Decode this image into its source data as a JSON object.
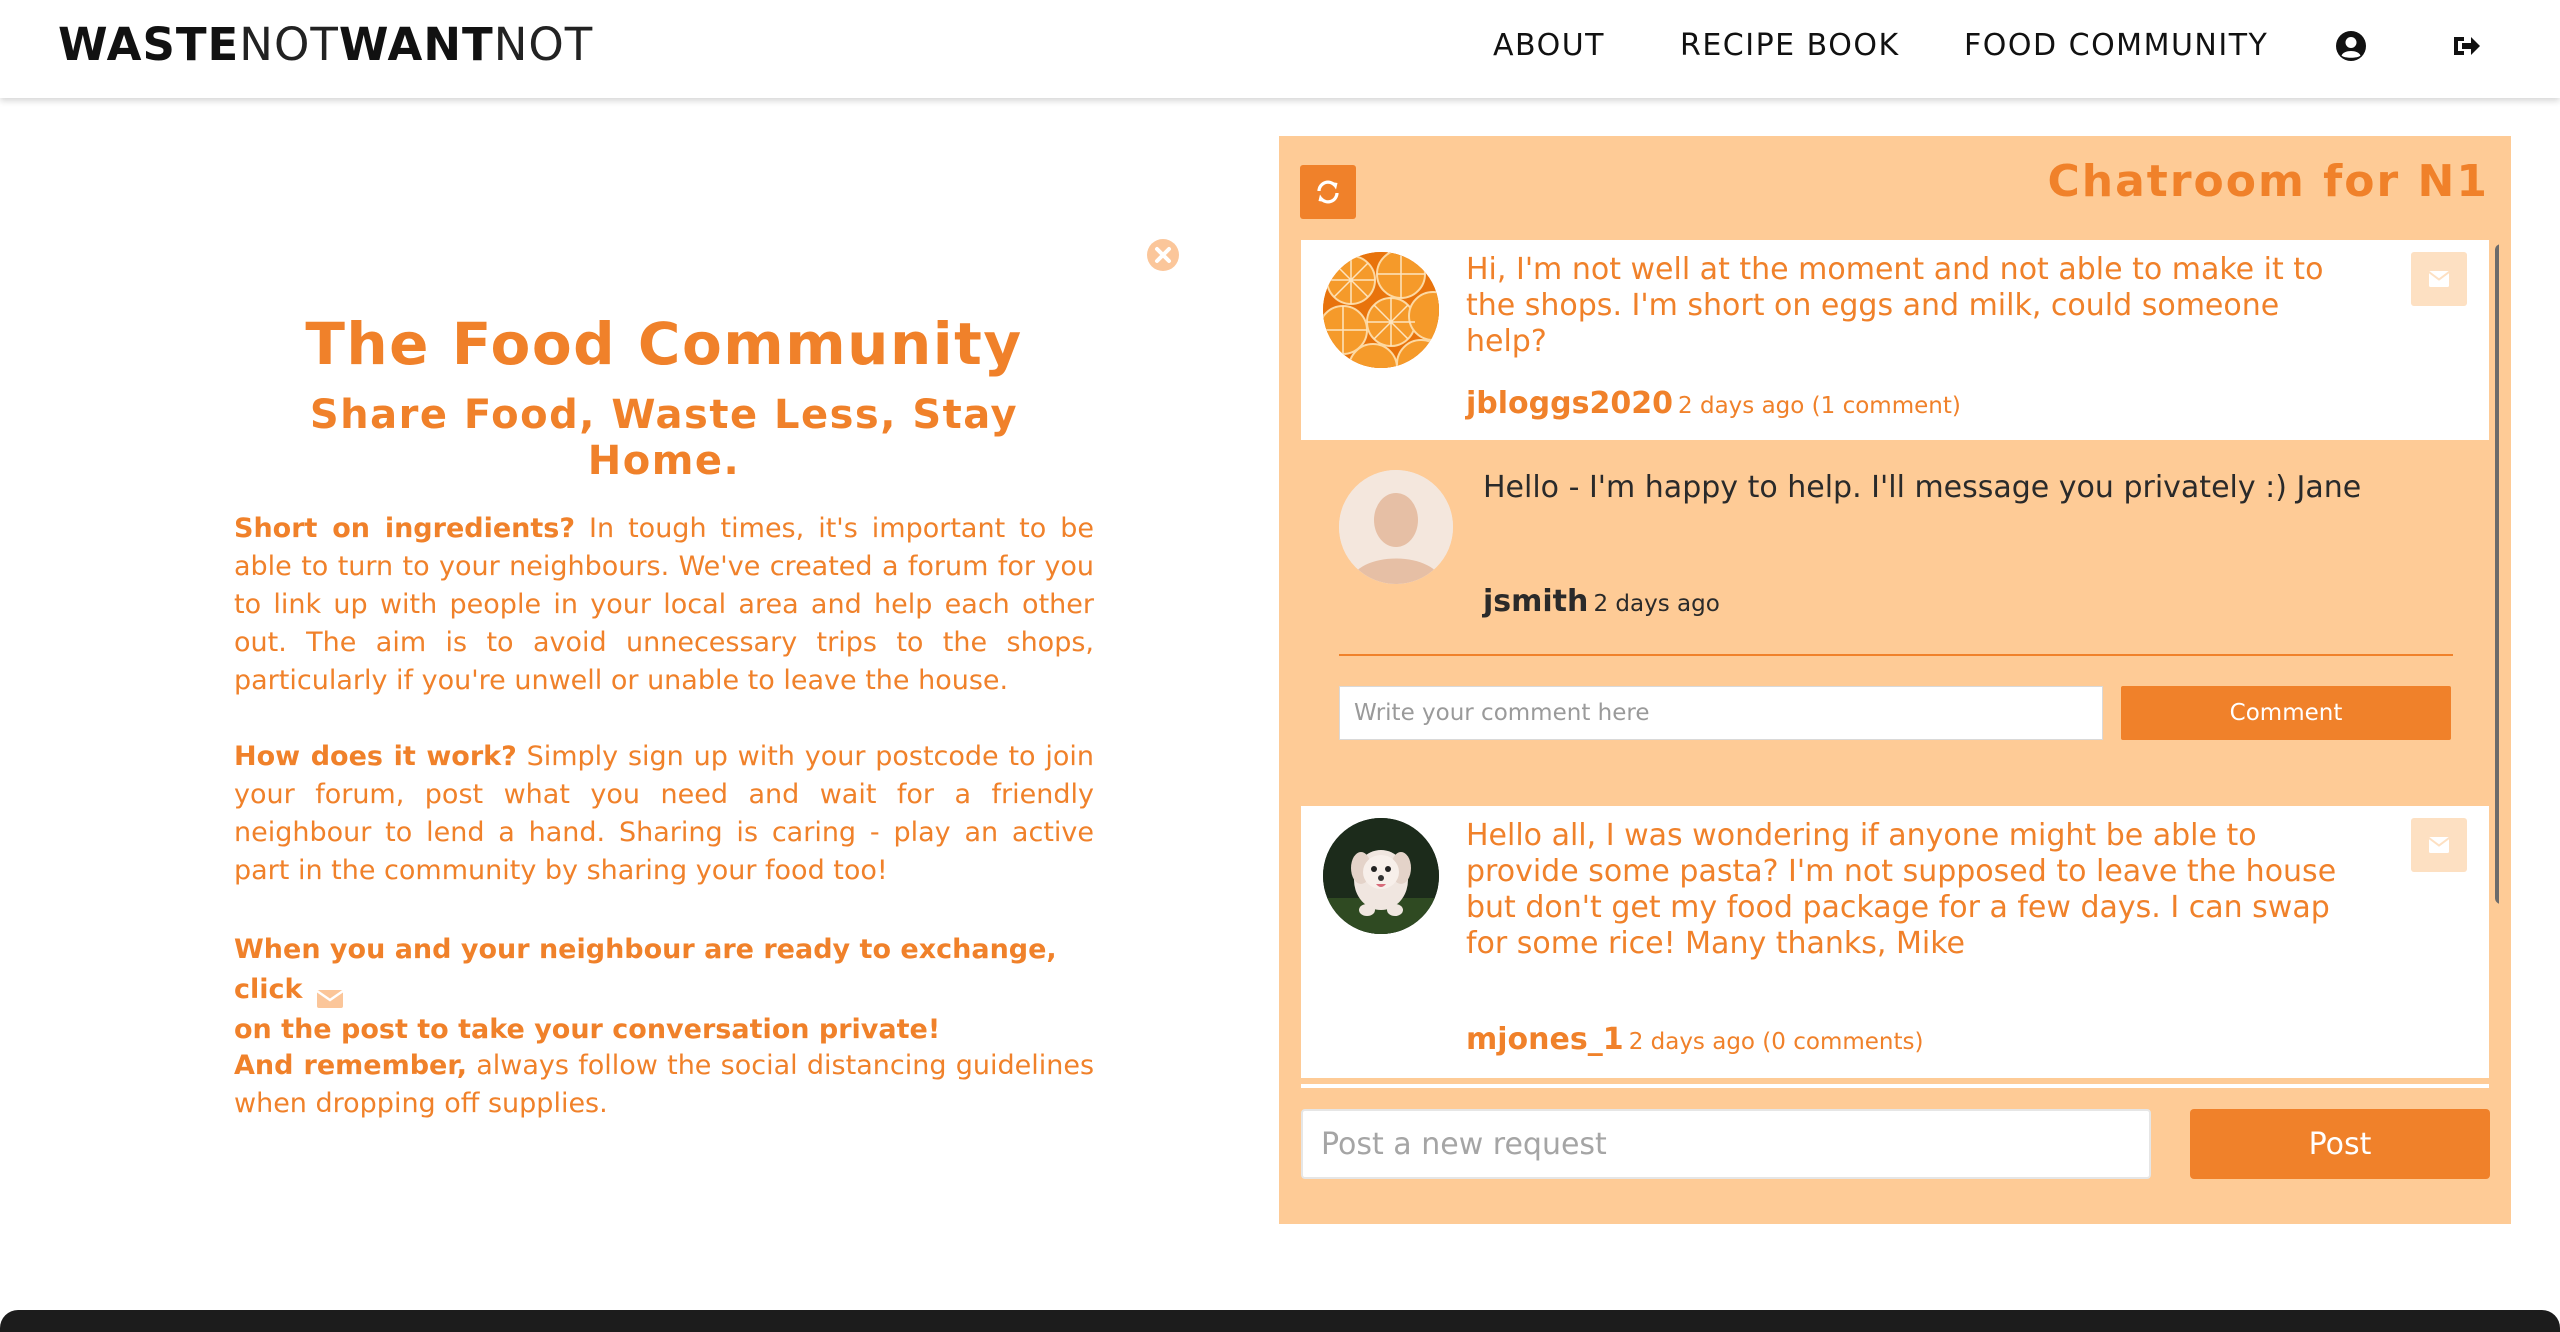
{
  "brand": {
    "part1": "WASTE",
    "part2": "NOT",
    "part3": "WANT",
    "part4": "NOT"
  },
  "nav": {
    "items": [
      {
        "label": "ABOUT"
      },
      {
        "label": "RECIPE BOOK"
      },
      {
        "label": "FOOD COMMUNITY"
      }
    ],
    "profile_icon": "user-circle-icon",
    "logout_icon": "sign-out-icon"
  },
  "info": {
    "title": "The Food Community",
    "subtitle": "Share Food, Waste Less, Stay Home.",
    "p1_lead": "Short on ingredients?",
    "p1_body": " In tough times, it's important to be able to turn to your neighbours. We've created a forum for you to link up with people in your local area and help each other out. The aim is to avoid unnecessary trips to the shops, particularly if you're unwell or unable to leave the house.",
    "p2_lead": "How does it work?",
    "p2_body": " Simply sign up with your postcode to join your forum, post what you need and wait for a friendly neighbour to lend a hand. Sharing is caring - play an active part in the community by sharing your food too!",
    "p3_part1": "When you and your neighbour are ready to exchange, click",
    "p3_part2": "on the post to take your conversation private!",
    "p4_lead": "And remember,",
    "p4_body": " always follow the social distancing guidelines when dropping off supplies."
  },
  "chatroom": {
    "title": "Chatroom for N1",
    "posts": [
      {
        "text": "Hi, I'm not well at the moment and not able to make it to the shops. I'm short on eggs and milk, could someone help?",
        "user": "jbloggs2020",
        "meta": "2 days ago (1 comment)",
        "avatar": "orange-slices-avatar",
        "comments": [
          {
            "text": "Hello - I'm happy to help. I'll message you privately :) Jane",
            "user": "jsmith",
            "meta": "2 days ago",
            "avatar": "default-user-avatar"
          }
        ],
        "comment_placeholder": "Write your comment here",
        "comment_button": "Comment"
      },
      {
        "text": "Hello all, I was wondering if anyone might be able to provide some pasta? I'm not supposed to leave the house but don't get my food package for a few days. I can swap for some rice! Many thanks, Mike",
        "user": "mjones_1",
        "meta": "2 days ago (0 comments)",
        "avatar": "puppy-avatar"
      }
    ],
    "new_request_placeholder": "Post a new request",
    "post_button": "Post"
  },
  "colors": {
    "accent": "#f0812a",
    "panel": "#fecb96",
    "mail_button": "#fde0c2"
  }
}
